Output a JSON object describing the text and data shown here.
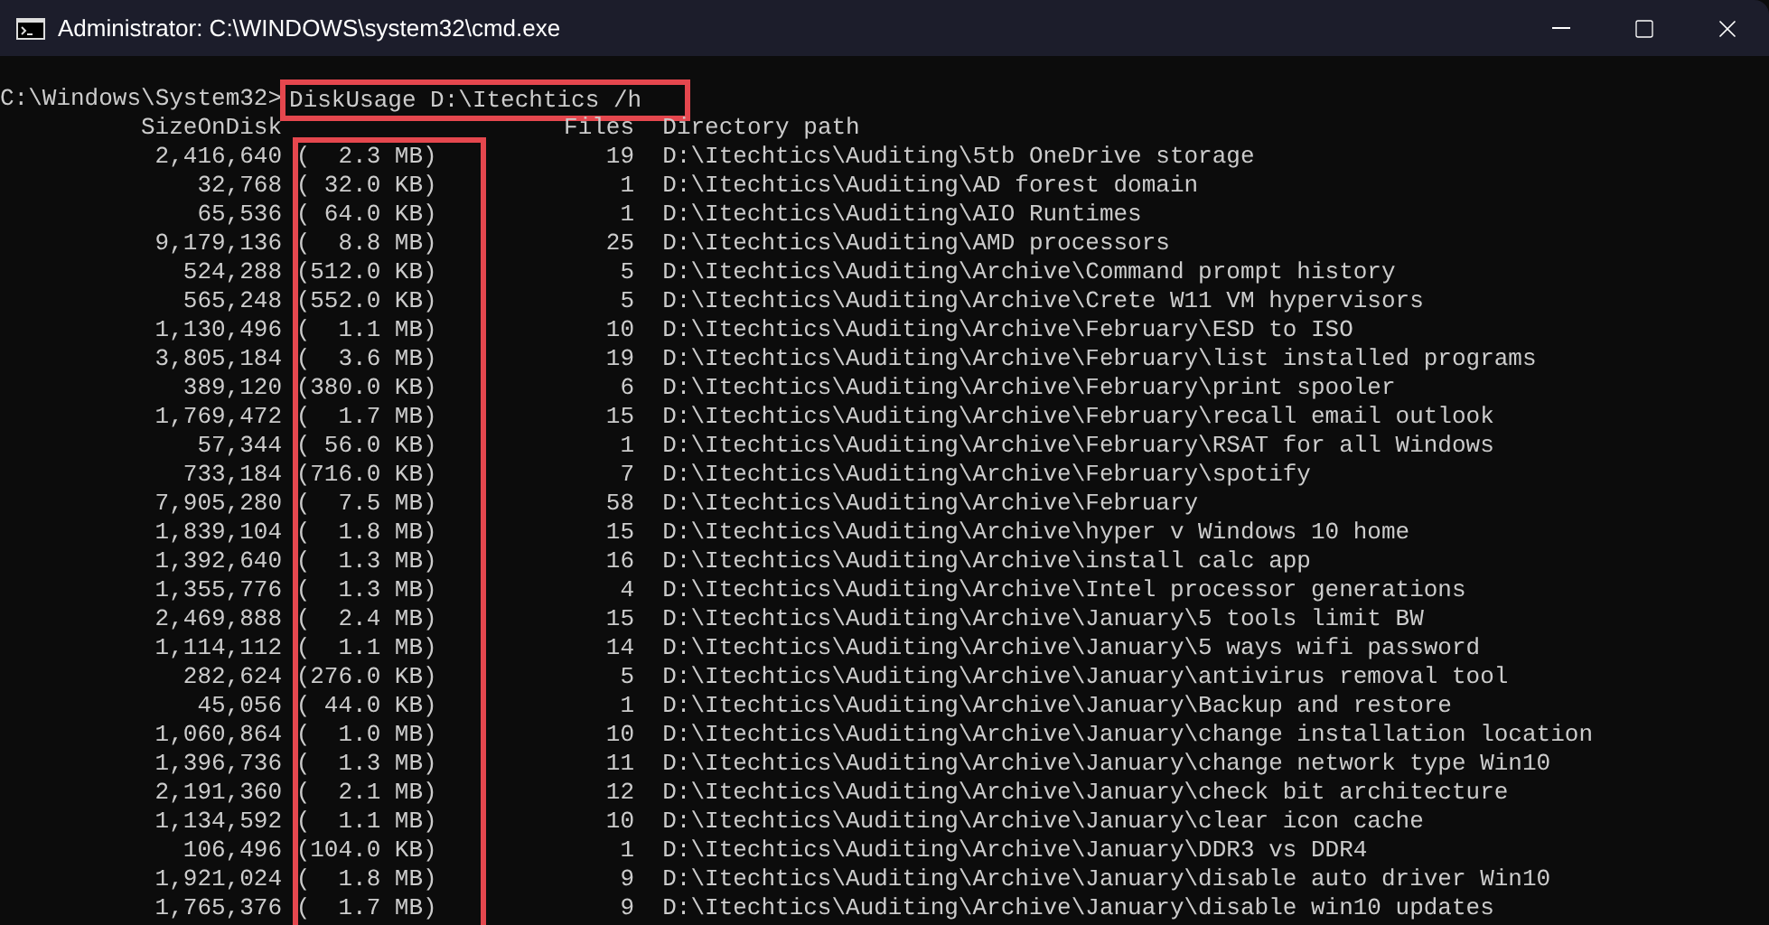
{
  "window": {
    "title": "Administrator: C:\\WINDOWS\\system32\\cmd.exe"
  },
  "terminal": {
    "prompt": "C:\\Windows\\System32>",
    "command": "DiskUsage D:\\Itechtics /h",
    "columns": [
      "SizeOnDisk",
      "Files",
      "Directory path"
    ],
    "rows": [
      {
        "size": "2,416,640",
        "human": "(  2.3 MB)",
        "files": "19",
        "path": "D:\\Itechtics\\Auditing\\5tb OneDrive storage"
      },
      {
        "size": "32,768",
        "human": "( 32.0 KB)",
        "files": "1",
        "path": "D:\\Itechtics\\Auditing\\AD forest domain"
      },
      {
        "size": "65,536",
        "human": "( 64.0 KB)",
        "files": "1",
        "path": "D:\\Itechtics\\Auditing\\AIO Runtimes"
      },
      {
        "size": "9,179,136",
        "human": "(  8.8 MB)",
        "files": "25",
        "path": "D:\\Itechtics\\Auditing\\AMD processors"
      },
      {
        "size": "524,288",
        "human": "(512.0 KB)",
        "files": "5",
        "path": "D:\\Itechtics\\Auditing\\Archive\\Command prompt history"
      },
      {
        "size": "565,248",
        "human": "(552.0 KB)",
        "files": "5",
        "path": "D:\\Itechtics\\Auditing\\Archive\\Crete W11 VM hypervisors"
      },
      {
        "size": "1,130,496",
        "human": "(  1.1 MB)",
        "files": "10",
        "path": "D:\\Itechtics\\Auditing\\Archive\\February\\ESD to ISO"
      },
      {
        "size": "3,805,184",
        "human": "(  3.6 MB)",
        "files": "19",
        "path": "D:\\Itechtics\\Auditing\\Archive\\February\\list installed programs"
      },
      {
        "size": "389,120",
        "human": "(380.0 KB)",
        "files": "6",
        "path": "D:\\Itechtics\\Auditing\\Archive\\February\\print spooler"
      },
      {
        "size": "1,769,472",
        "human": "(  1.7 MB)",
        "files": "15",
        "path": "D:\\Itechtics\\Auditing\\Archive\\February\\recall email outlook"
      },
      {
        "size": "57,344",
        "human": "( 56.0 KB)",
        "files": "1",
        "path": "D:\\Itechtics\\Auditing\\Archive\\February\\RSAT for all Windows"
      },
      {
        "size": "733,184",
        "human": "(716.0 KB)",
        "files": "7",
        "path": "D:\\Itechtics\\Auditing\\Archive\\February\\spotify"
      },
      {
        "size": "7,905,280",
        "human": "(  7.5 MB)",
        "files": "58",
        "path": "D:\\Itechtics\\Auditing\\Archive\\February"
      },
      {
        "size": "1,839,104",
        "human": "(  1.8 MB)",
        "files": "15",
        "path": "D:\\Itechtics\\Auditing\\Archive\\hyper v Windows 10 home"
      },
      {
        "size": "1,392,640",
        "human": "(  1.3 MB)",
        "files": "16",
        "path": "D:\\Itechtics\\Auditing\\Archive\\install calc app"
      },
      {
        "size": "1,355,776",
        "human": "(  1.3 MB)",
        "files": "4",
        "path": "D:\\Itechtics\\Auditing\\Archive\\Intel processor generations"
      },
      {
        "size": "2,469,888",
        "human": "(  2.4 MB)",
        "files": "15",
        "path": "D:\\Itechtics\\Auditing\\Archive\\January\\5 tools limit BW"
      },
      {
        "size": "1,114,112",
        "human": "(  1.1 MB)",
        "files": "14",
        "path": "D:\\Itechtics\\Auditing\\Archive\\January\\5 ways wifi password"
      },
      {
        "size": "282,624",
        "human": "(276.0 KB)",
        "files": "5",
        "path": "D:\\Itechtics\\Auditing\\Archive\\January\\antivirus removal tool"
      },
      {
        "size": "45,056",
        "human": "( 44.0 KB)",
        "files": "1",
        "path": "D:\\Itechtics\\Auditing\\Archive\\January\\Backup and restore"
      },
      {
        "size": "1,060,864",
        "human": "(  1.0 MB)",
        "files": "10",
        "path": "D:\\Itechtics\\Auditing\\Archive\\January\\change installation location"
      },
      {
        "size": "1,396,736",
        "human": "(  1.3 MB)",
        "files": "11",
        "path": "D:\\Itechtics\\Auditing\\Archive\\January\\change network type Win10"
      },
      {
        "size": "2,191,360",
        "human": "(  2.1 MB)",
        "files": "12",
        "path": "D:\\Itechtics\\Auditing\\Archive\\January\\check bit architecture"
      },
      {
        "size": "1,134,592",
        "human": "(  1.1 MB)",
        "files": "10",
        "path": "D:\\Itechtics\\Auditing\\Archive\\January\\clear icon cache"
      },
      {
        "size": "106,496",
        "human": "(104.0 KB)",
        "files": "1",
        "path": "D:\\Itechtics\\Auditing\\Archive\\January\\DDR3 vs DDR4"
      },
      {
        "size": "1,921,024",
        "human": "(  1.8 MB)",
        "files": "9",
        "path": "D:\\Itechtics\\Auditing\\Archive\\January\\disable auto driver Win10"
      },
      {
        "size": "1,765,376",
        "human": "(  1.7 MB)",
        "files": "9",
        "path": "D:\\Itechtics\\Auditing\\Archive\\January\\disable win10 updates"
      }
    ]
  }
}
